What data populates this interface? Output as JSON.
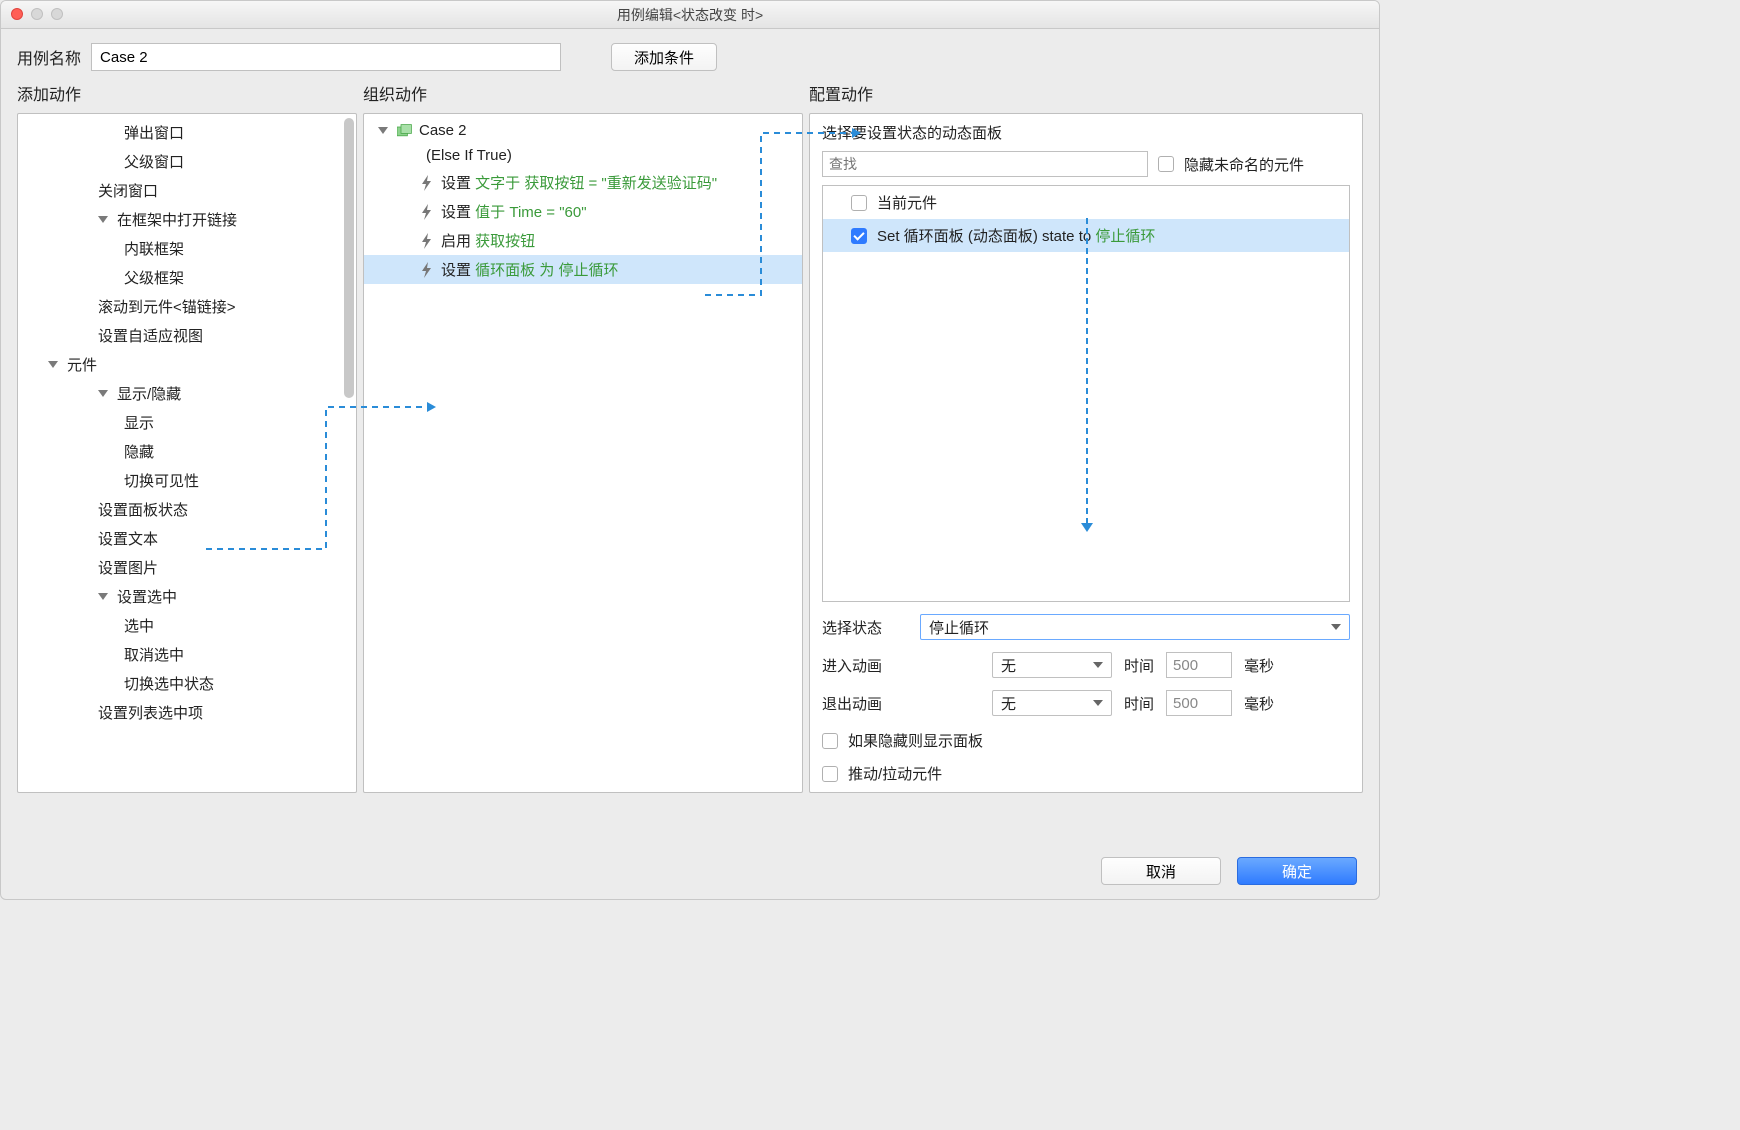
{
  "window": {
    "title": "用例编辑<状态改变 时>"
  },
  "header": {
    "case_label": "用例名称",
    "case_value": "Case 2",
    "add_condition_btn": "添加条件"
  },
  "cols": {
    "add_action": "添加动作",
    "organize_action": "组织动作",
    "configure_action": "配置动作"
  },
  "tree": {
    "i1": "弹出窗口",
    "i2": "父级窗口",
    "i3": "关闭窗口",
    "i4": "在框架中打开链接",
    "i5": "内联框架",
    "i6": "父级框架",
    "i7": "滚动到元件<锚链接>",
    "i8": "设置自适应视图",
    "g2": "元件",
    "i9": "显示/隐藏",
    "i10": "显示",
    "i11": "隐藏",
    "i12": "切换可见性",
    "i13": "设置面板状态",
    "i14": "设置文本",
    "i15": "设置图片",
    "i16": "设置选中",
    "i17": "选中",
    "i18": "取消选中",
    "i19": "切换选中状态",
    "i20": "设置列表选中项"
  },
  "org": {
    "case_name": "Case 2",
    "case_cond": "(Else If True)",
    "a1_prefix": "设置 ",
    "a1_part1": "文字于 获取按钮 = \"重新发送验证码\"",
    "a2_prefix": "设置 ",
    "a2_part1": "值于 Time = \"60\"",
    "a3_prefix": "启用 ",
    "a3_part1": "获取按钮",
    "a4_prefix": "设置 ",
    "a4_part1": "循环面板 为 停止循环"
  },
  "cfg": {
    "section_title": "选择要设置状态的动态面板",
    "search_placeholder": "查找",
    "hide_unnamed": "隐藏未命名的元件",
    "current_widget": "当前元件",
    "row_text_a": "Set 循环面板 (动态面板) state to ",
    "row_text_b": "停止循环",
    "select_state_label": "选择状态",
    "select_state_value": "停止循环",
    "anim_in_label": "进入动画",
    "anim_out_label": "退出动画",
    "anim_value": "无",
    "time_label": "时间",
    "time_value": "500",
    "ms": "毫秒",
    "chk_show_if_hidden": "如果隐藏则显示面板",
    "chk_push_pull": "推动/拉动元件"
  },
  "footer": {
    "cancel": "取消",
    "ok": "确定"
  }
}
